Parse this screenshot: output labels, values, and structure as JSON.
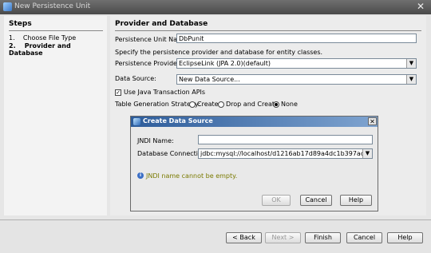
{
  "window": {
    "title": "New Persistence Unit"
  },
  "steps": {
    "heading": "Steps",
    "items": [
      {
        "num": "1.",
        "label": "Choose File Type"
      },
      {
        "num": "2.",
        "label": "Provider and Database"
      }
    ]
  },
  "main": {
    "heading": "Provider and Database",
    "unit_name_label": "Persistence Unit Name:",
    "unit_name_value": "DbPunit",
    "hint": "Specify the persistence provider and database for entity classes.",
    "provider_label": "Persistence Provider:",
    "provider_value": "EclipseLink (JPA 2.0)(default)",
    "datasource_label": "Data Source:",
    "datasource_value": "New Data Source...",
    "jta_label": "Use Java Transaction APIs",
    "jta_checked": true,
    "strategy_label": "Table Generation Strategy:",
    "strategies": [
      "Create",
      "Drop and Create",
      "None"
    ],
    "strategy_selected": "None"
  },
  "dialog": {
    "title": "Create Data Source",
    "jndi_label": "JNDI Name:",
    "jndi_value": "",
    "conn_label": "Database Connection:",
    "conn_value": "jdbc:mysql://localhost/d1216ab17d89a4dc1b397ac89a5c57...",
    "error": "JNDI name cannot be empty.",
    "ok": "OK",
    "cancel": "Cancel",
    "help": "Help"
  },
  "wizard_buttons": {
    "back": "< Back",
    "next": "Next >",
    "finish": "Finish",
    "cancel": "Cancel",
    "help": "Help"
  }
}
